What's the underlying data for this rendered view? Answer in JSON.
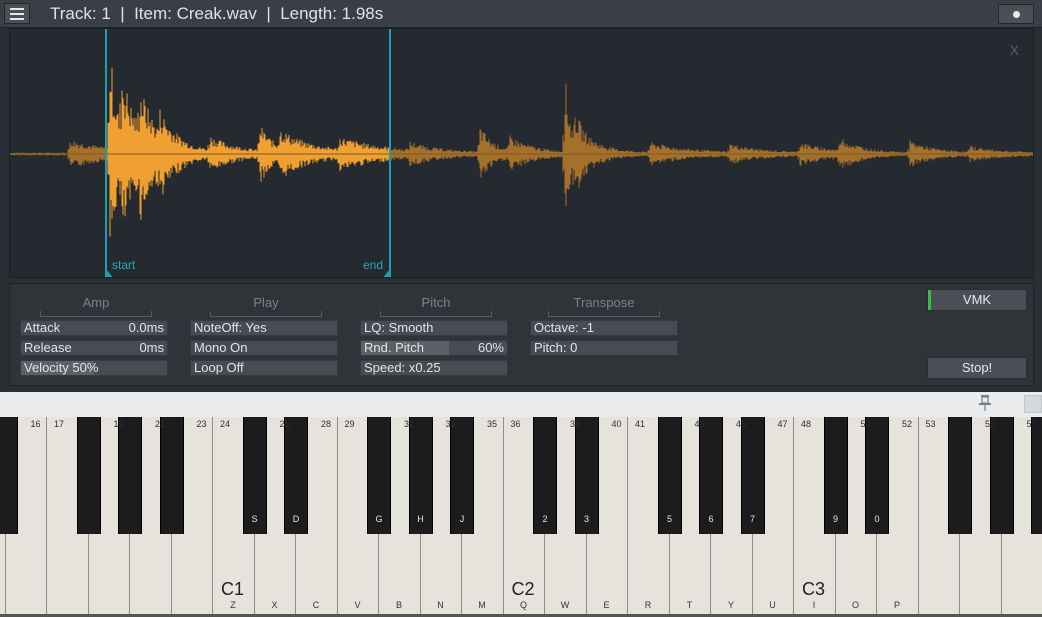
{
  "title": {
    "text": "Track: 1  |  Item: Creak.wav  |  Length: 1.98s"
  },
  "waveform": {
    "close_label": "X",
    "start_label": "start",
    "end_label": "end",
    "colors": {
      "background": "#252a31",
      "wave_selected": "#f0a030",
      "wave_unselected": "#a4702a",
      "marker": "#1b9fb3"
    },
    "selection": {
      "start_fraction": 0.095,
      "end_fraction": 0.37
    }
  },
  "groups": {
    "amp": "Amp",
    "play": "Play",
    "pitch": "Pitch",
    "transpose": "Transpose"
  },
  "amp": {
    "attack_label": "Attack",
    "attack_value": "0.0ms",
    "release_label": "Release",
    "release_value": "0ms",
    "velocity_label": "Velocity 50%",
    "velocity_fraction": 0.5
  },
  "play": {
    "noteoff": "NoteOff: Yes",
    "mono": "Mono On",
    "loop": "Loop Off"
  },
  "pitch": {
    "lq": "LQ: Smooth",
    "rnd_label": "Rnd. Pitch",
    "rnd_value": "60%",
    "rnd_fraction": 0.6,
    "speed": "Speed: x0.25"
  },
  "transpose": {
    "octave": "Octave: -1",
    "pitch": "Pitch: 0"
  },
  "buttons": {
    "vmk": "VMK",
    "stop": "Stop!",
    "vmk_indicator_color": "#3dbb4a"
  },
  "keyboard": {
    "white_numbers": [
      "16",
      "17",
      "19",
      "21",
      "23",
      "24",
      "26",
      "28",
      "29",
      "31",
      "33",
      "35",
      "36",
      "38",
      "40",
      "41",
      "43",
      "45",
      "47",
      "48",
      "50",
      "52",
      "53",
      "55",
      "57"
    ],
    "black_letters": [
      "S",
      "D",
      "G",
      "H",
      "J",
      "2",
      "3",
      "5",
      "6",
      "7",
      "9",
      "0"
    ],
    "white_letters": [
      "Z",
      "X",
      "C",
      "V",
      "B",
      "N",
      "M",
      "Q",
      "W",
      "E",
      "R",
      "T",
      "Y",
      "U",
      "I",
      "O",
      "P"
    ],
    "octave_labels": [
      "C1",
      "C2",
      "C3"
    ]
  }
}
